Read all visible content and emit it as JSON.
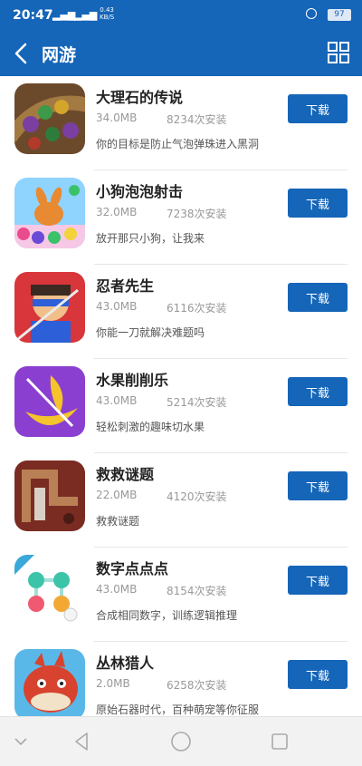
{
  "status_bar": {
    "time": "20:47",
    "signal_1": "▂▄▆",
    "signal_2": "▂▄▆",
    "net_speed": "0.43",
    "net_unit": "KB/S",
    "battery": "97"
  },
  "header": {
    "title": "网游",
    "back_icon": "chevron-left-icon",
    "menu_icon": "grid-icon"
  },
  "colors": {
    "brand": "#1565b8"
  },
  "apps": [
    {
      "name": "大理石的传说",
      "size": "34.0MB",
      "installs": "8234次安装",
      "desc": "你的目标是防止气泡弹珠进入黑洞",
      "button": "下载"
    },
    {
      "name": "小狗泡泡射击",
      "size": "32.0MB",
      "installs": "7238次安装",
      "desc": "放开那只小狗，让我来",
      "button": "下载"
    },
    {
      "name": "忍者先生",
      "size": "43.0MB",
      "installs": "6116次安装",
      "desc": "你能一刀就解决难题吗",
      "button": "下载"
    },
    {
      "name": "水果削削乐",
      "size": "43.0MB",
      "installs": "5214次安装",
      "desc": "轻松刺激的趣味切水果",
      "button": "下载"
    },
    {
      "name": "救救谜题",
      "size": "22.0MB",
      "installs": "4120次安装",
      "desc": "救救谜题",
      "button": "下载"
    },
    {
      "name": "数字点点点",
      "size": "43.0MB",
      "installs": "8154次安装",
      "desc": "合成相同数字，训练逻辑推理",
      "button": "下载"
    },
    {
      "name": "丛林猎人",
      "size": "2.0MB",
      "installs": "6258次安装",
      "desc": "原始石器时代，百种萌宠等你征服",
      "button": "下载"
    }
  ],
  "nav_bar": {
    "down_icon": "chevron-down-icon",
    "back_icon": "triangle-back-icon",
    "home_icon": "circle-home-icon",
    "recent_icon": "square-recents-icon"
  }
}
